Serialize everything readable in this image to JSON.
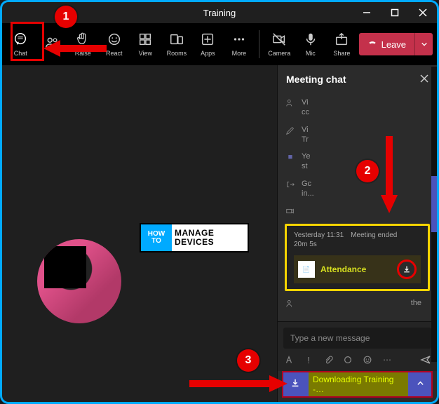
{
  "title": "Training",
  "toolbar": {
    "chat": "Chat",
    "people": "",
    "raise": "Raise",
    "react": "React",
    "view": "View",
    "rooms": "Rooms",
    "apps": "Apps",
    "more": "More",
    "camera": "Camera",
    "mic": "Mic",
    "share": "Share",
    "leave": "Leave"
  },
  "logo": {
    "how1": "HOW",
    "how2": "TO",
    "line1": "MANAGE",
    "line2": "DEVICES"
  },
  "panel": {
    "title": "Meeting chat",
    "rows": [
      {
        "icon": "people",
        "text": "Vi\ncc"
      },
      {
        "icon": "pencil",
        "text": "Vi\nTr"
      },
      {
        "icon": "video",
        "text": "Ye\nst"
      },
      {
        "icon": "exit",
        "text": "Gc\nin..."
      },
      {
        "icon": "video-off",
        "text": ""
      }
    ]
  },
  "card": {
    "time": "Yesterday 11:31",
    "status": "Meeting ended",
    "duration": "20m 5s",
    "file": "Attendance"
  },
  "after": {
    "text": "the"
  },
  "compose": {
    "placeholder": "Type a new message"
  },
  "download": {
    "text": "Downloading Training -…"
  },
  "annotations": {
    "b1": "1",
    "b2": "2",
    "b3": "3"
  }
}
